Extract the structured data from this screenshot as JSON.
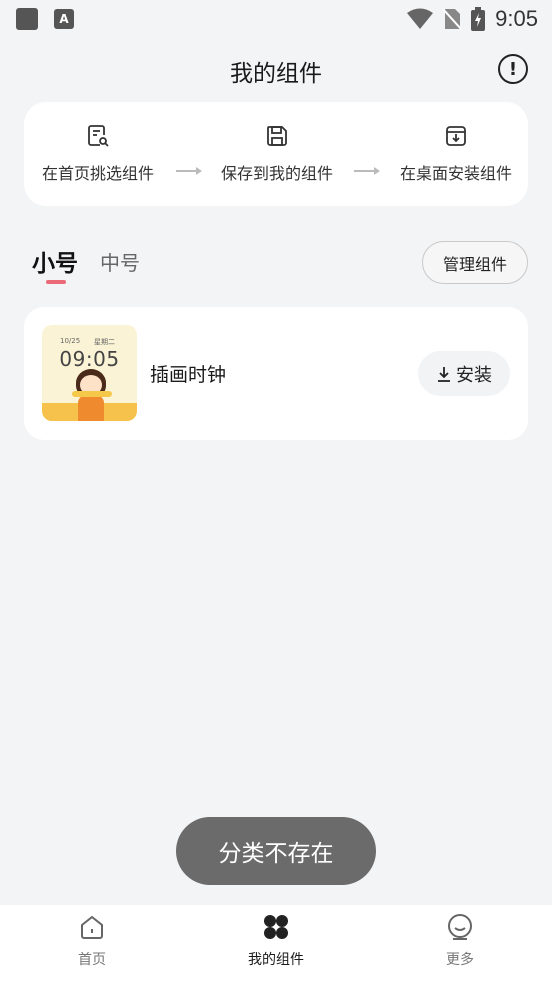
{
  "status_bar": {
    "time": "9:05"
  },
  "header": {
    "title": "我的组件"
  },
  "steps": [
    {
      "label": "在首页挑选组件",
      "icon": "search-document-icon"
    },
    {
      "label": "保存到我的组件",
      "icon": "save-icon"
    },
    {
      "label": "在桌面安装组件",
      "icon": "install-box-icon"
    }
  ],
  "tabs": {
    "small": "小号",
    "medium": "中号"
  },
  "manage_label": "管理组件",
  "widget": {
    "name": "插画时钟",
    "thumb_date": "10/25",
    "thumb_weekday": "星期二",
    "thumb_time": "09:05",
    "install_label": "安装"
  },
  "toast": "分类不存在",
  "nav": [
    {
      "label": "首页",
      "icon": "home-icon"
    },
    {
      "label": "我的组件",
      "icon": "clover-icon"
    },
    {
      "label": "更多",
      "icon": "face-icon"
    }
  ],
  "colors": {
    "accent": "#ec6a78",
    "background": "#f3f4f6",
    "toast": "#6b6b6b"
  }
}
